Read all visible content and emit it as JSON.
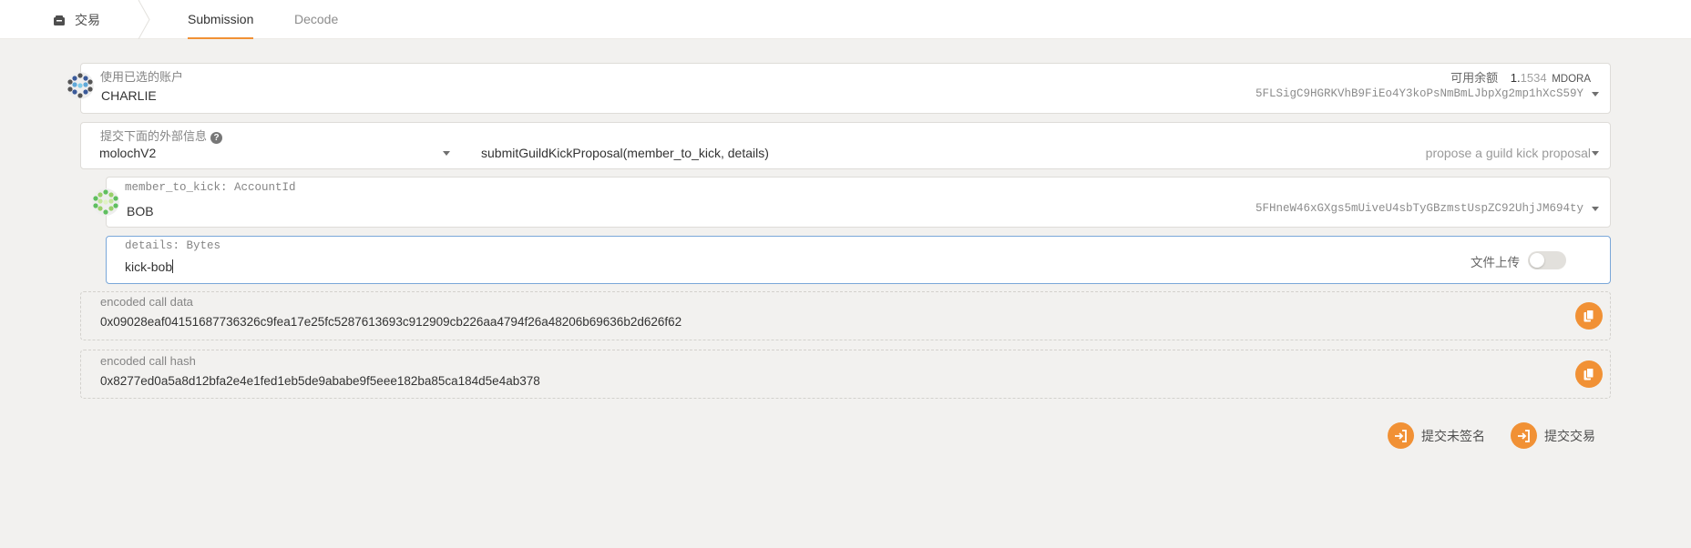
{
  "header": {
    "app_title": "交易",
    "app_icon": "transaction-icon",
    "tabs": [
      {
        "label": "Submission",
        "active": true
      },
      {
        "label": "Decode",
        "active": false
      }
    ]
  },
  "account": {
    "label": "使用已选的账户",
    "name": "CHARLIE",
    "address": "5FLSigC9HGRKVhB9FiEo4Y3koPsNmBmLJbpXg2mp1hXcS59Y",
    "balance_label": "可用余额",
    "balance_int": "1.",
    "balance_dec": "1534",
    "balance_unit": "MDORA"
  },
  "extrinsic": {
    "label": "提交下面的外部信息",
    "module": "molochV2",
    "method": "submitGuildKickProposal(member_to_kick, details)",
    "method_desc": "propose a guild kick proposal"
  },
  "params": {
    "member_label": "member_to_kick: AccountId",
    "member_name": "BOB",
    "member_address": "5FHneW46xGXgs5mUiveU4sbTyGBzmstUspZC92UhjJM694ty",
    "details_label": "details: Bytes",
    "details_value": "kick-bob",
    "file_upload_label": "文件上传"
  },
  "encoded": {
    "call_data_label": "encoded call data",
    "call_data": "0x09028eaf04151687736326c9fea17e25fc5287613693c912909cb226aa4794f26a48206b69636b2d626f62",
    "call_hash_label": "encoded call hash",
    "call_hash": "0x8277ed0a5a8d12bfa2e4e1fed1eb5de9ababe9f5eee182ba85ca184d5e4ab378"
  },
  "actions": {
    "submit_unsigned": "提交未签名",
    "submit": "提交交易"
  },
  "colors": {
    "accent": "#f19135",
    "focus_border": "#7aa7d9",
    "background": "#f2f1ef"
  }
}
